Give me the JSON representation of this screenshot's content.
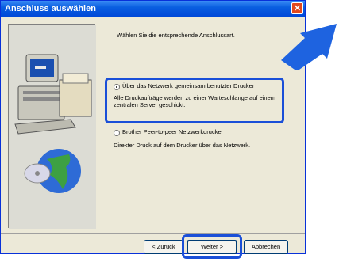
{
  "window": {
    "title": "Anschluss auswählen",
    "close_glyph": "✕"
  },
  "prompt": "Wählen Sie die entsprechende Anschlussart.",
  "options": [
    {
      "label": "Über das Netzwerk gemeinsam benutzter Drucker",
      "description": "Alle Druckaufträge werden zu einer Warteschlange auf einem zentralen Server geschickt.",
      "checked": true
    },
    {
      "label": "Brother Peer-to-peer Netzwerkdrucker",
      "description": "Direkter Druck auf dem Drucker über das Netzwerk.",
      "checked": false
    }
  ],
  "buttons": {
    "back": "< Zurück",
    "next": "Weiter >",
    "cancel": "Abbrechen"
  },
  "colors": {
    "highlight": "#1a4fd8",
    "titlebar": "#0a5fe0",
    "arrow": "#1e63e0"
  },
  "icons": [
    "computer-icon",
    "globe-icon",
    "cd-icon",
    "pointer-arrow-icon",
    "close-icon"
  ]
}
